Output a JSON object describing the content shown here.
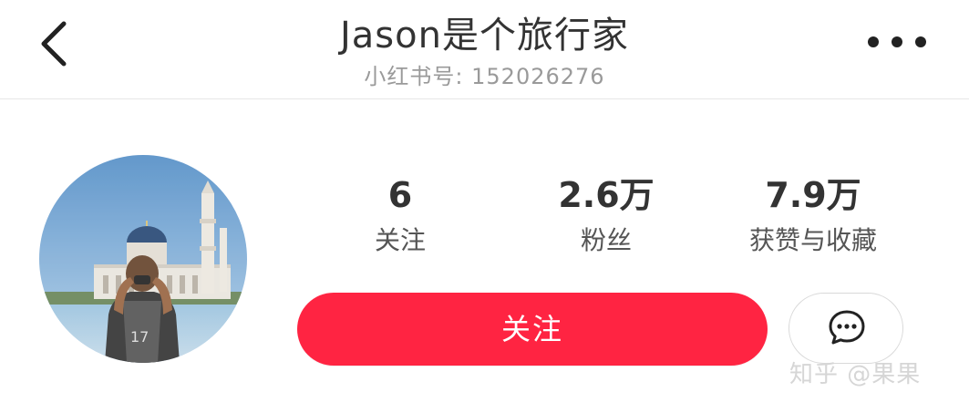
{
  "header": {
    "title": "Jason是个旅行家",
    "subtitle": "小红书号: 152026276",
    "back_icon": "chevron-left-icon",
    "more_icon": "more-horizontal-icon"
  },
  "profile": {
    "avatar_alt": "avatar"
  },
  "stats": [
    {
      "value": "6",
      "label": "关注"
    },
    {
      "value": "2.6万",
      "label": "粉丝"
    },
    {
      "value": "7.9万",
      "label": "获赞与收藏"
    }
  ],
  "actions": {
    "follow_label": "关注",
    "message_icon": "chat-bubble-icon"
  },
  "watermark": "知乎 @果果",
  "colors": {
    "accent": "#ff2442",
    "title": "#333333",
    "subtitle": "#9a9a9a"
  }
}
